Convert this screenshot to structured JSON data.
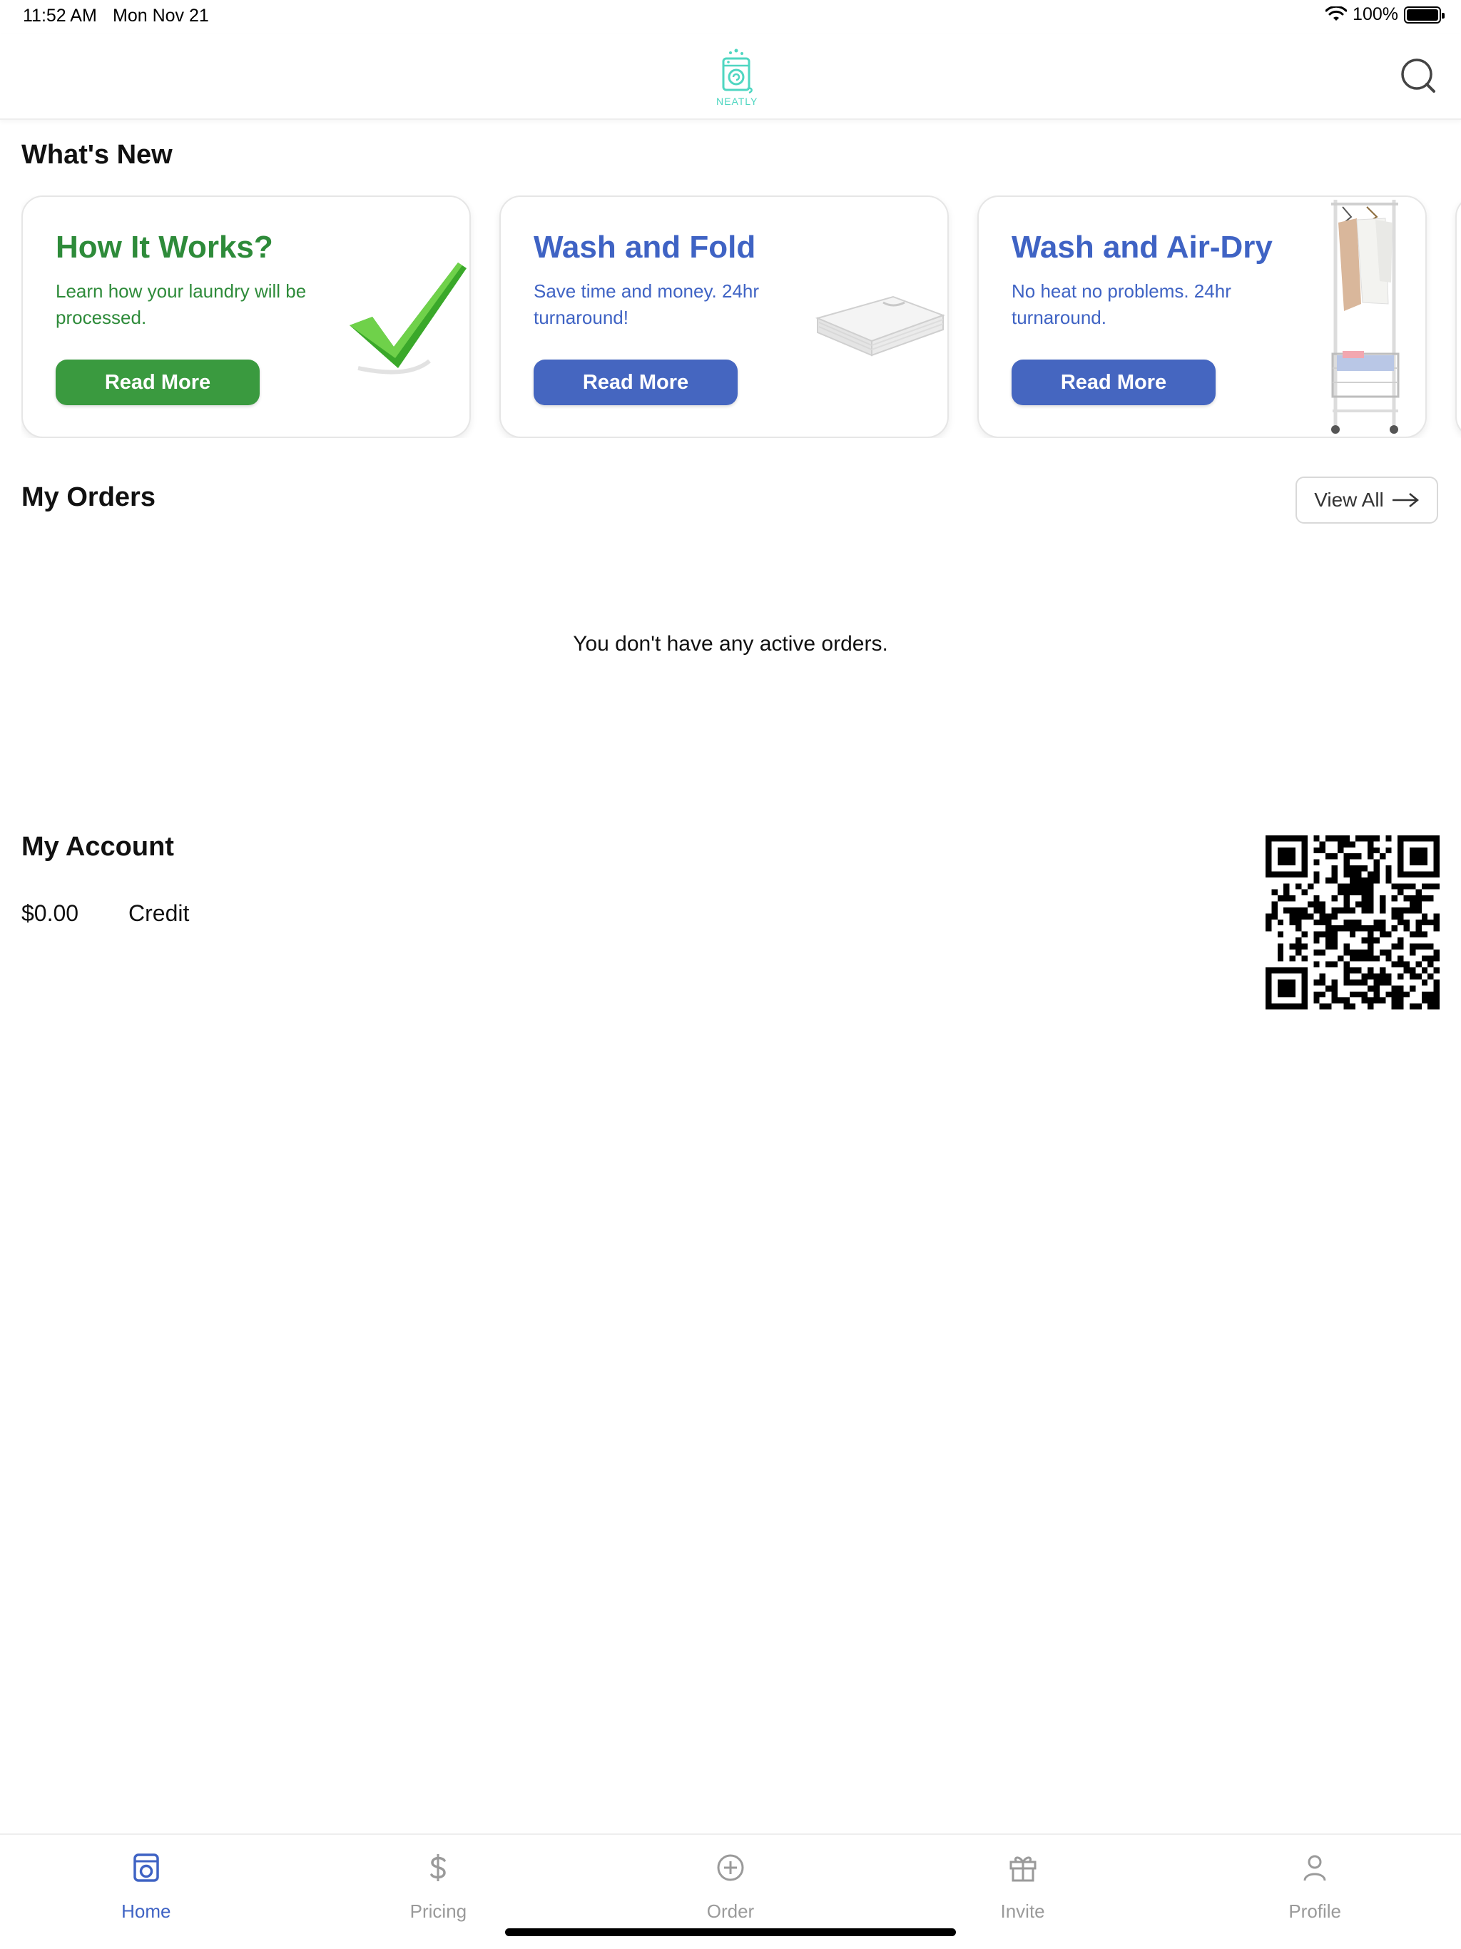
{
  "status_bar": {
    "time": "11:52 AM",
    "date": "Mon Nov 21",
    "battery": "100%"
  },
  "header": {
    "logo_text": "NEATLY",
    "logo_icon": "washing-machine-icon",
    "chat_icon": "chat-bubble-icon"
  },
  "whats_new": {
    "title": "What's New",
    "cards": [
      {
        "title": "How It Works?",
        "description": "Learn how your laundry will be processed.",
        "button": "Read More",
        "color": "#3a9a3f",
        "illustration": "green-checkmark"
      },
      {
        "title": "Wash and Fold",
        "description": "Save time and money. 24hr turnaround!",
        "button": "Read More",
        "color": "#4566c0",
        "illustration": "folded-shirts"
      },
      {
        "title": "Wash and Air-Dry",
        "description": "No heat no problems. 24hr turnaround.",
        "button": "Read More",
        "color": "#4566c0",
        "illustration": "clothes-rack"
      }
    ]
  },
  "orders": {
    "title": "My Orders",
    "view_all": "View All",
    "empty_message": "You don't have any active orders."
  },
  "account": {
    "title": "My Account",
    "credit_amount": "$0.00",
    "credit_label": "Credit",
    "qr_icon": "qr-code"
  },
  "tabs": [
    {
      "label": "Home",
      "icon": "home-washer-icon",
      "active": true
    },
    {
      "label": "Pricing",
      "icon": "dollar-icon",
      "active": false
    },
    {
      "label": "Order",
      "icon": "plus-circle-icon",
      "active": false
    },
    {
      "label": "Invite",
      "icon": "gift-icon",
      "active": false
    },
    {
      "label": "Profile",
      "icon": "person-icon",
      "active": false
    }
  ],
  "colors": {
    "green": "#3a9a3f",
    "blue": "#4566c0",
    "brand_teal": "#4fd6c1",
    "inactive_tab": "#9a9a9a"
  }
}
